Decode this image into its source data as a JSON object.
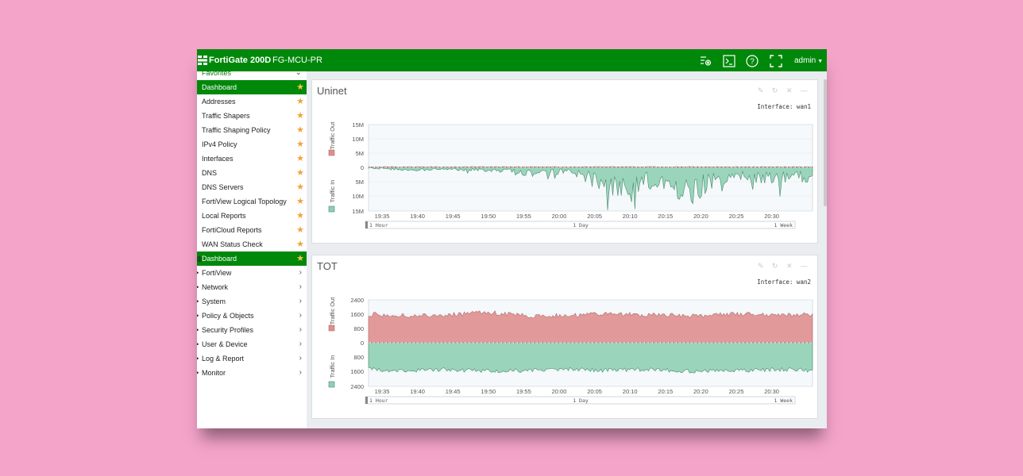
{
  "topbar": {
    "product": "FortiGate 200D",
    "hostname": "FG-MCU-PR",
    "user": "admin",
    "icons": [
      "dashboard-settings-icon",
      "cli-console-icon",
      "help-icon",
      "fullscreen-icon"
    ],
    "color": "#00880a"
  },
  "sidebar": {
    "favorites_label": "Favorites",
    "favorites": [
      {
        "label": "Dashboard",
        "active": true
      },
      {
        "label": "Addresses"
      },
      {
        "label": "Traffic Shapers"
      },
      {
        "label": "Traffic Shaping Policy"
      },
      {
        "label": "IPv4 Policy"
      },
      {
        "label": "Interfaces"
      },
      {
        "label": "DNS"
      },
      {
        "label": "DNS Servers"
      },
      {
        "label": "FortiView Logical Topology"
      },
      {
        "label": "Local Reports"
      },
      {
        "label": "FortiCloud Reports"
      },
      {
        "label": "WAN Status Check"
      }
    ],
    "menu": [
      {
        "label": "Dashboard",
        "active": true
      },
      {
        "label": "FortiView"
      },
      {
        "label": "Network"
      },
      {
        "label": "System"
      },
      {
        "label": "Policy & Objects"
      },
      {
        "label": "Security Profiles"
      },
      {
        "label": "User & Device"
      },
      {
        "label": "Log & Report"
      },
      {
        "label": "Monitor"
      }
    ]
  },
  "widgets": [
    {
      "title": "Uninet",
      "interface": "Interface: wan1",
      "out_label": "Traffic Out",
      "in_label": "Traffic In",
      "y_ticks_out": [
        "15M",
        "10M",
        "5M",
        "0"
      ],
      "y_ticks_in": [
        "5M",
        "10M",
        "15M"
      ],
      "x_ticks": [
        "19:35",
        "19:40",
        "19:45",
        "19:50",
        "19:55",
        "20:00",
        "20:05",
        "20:10",
        "20:15",
        "20:20",
        "20:25",
        "20:30"
      ],
      "range_labels": [
        "1 Hour",
        "1 Day",
        "1 Week"
      ]
    },
    {
      "title": "TOT",
      "interface": "Interface: wan2",
      "out_label": "Traffic Out",
      "in_label": "Traffic In",
      "y_ticks_out": [
        "2400",
        "1600",
        "800",
        "0"
      ],
      "y_ticks_in": [
        "800",
        "1600",
        "2400"
      ],
      "x_ticks": [
        "19:35",
        "19:40",
        "19:45",
        "19:50",
        "19:55",
        "20:00",
        "20:05",
        "20:10",
        "20:15",
        "20:20",
        "20:25",
        "20:30"
      ],
      "range_labels": [
        "1 Hour",
        "1 Day",
        "1 Week"
      ]
    }
  ],
  "chart_data": [
    {
      "type": "area",
      "title": "Uninet",
      "x": [
        "19:35",
        "19:40",
        "19:45",
        "19:50",
        "19:55",
        "20:00",
        "20:05",
        "20:10",
        "20:15",
        "20:20",
        "20:25",
        "20:30"
      ],
      "series": [
        {
          "name": "Traffic Out",
          "values": [
            0.2,
            0.2,
            0.2,
            0.2,
            0.2,
            0.2,
            0.2,
            0.2,
            0.2,
            0.2,
            0.2,
            0.2
          ],
          "unit": "M",
          "color": "#e08e8e"
        },
        {
          "name": "Traffic In",
          "values": [
            0.3,
            1.0,
            0.8,
            1.2,
            2.5,
            1.5,
            8.0,
            6.0,
            10.0,
            3.0,
            5.0,
            4.0
          ],
          "unit": "M",
          "color": "#8fcfb4"
        }
      ],
      "ylim": [
        -15,
        15
      ]
    },
    {
      "type": "area",
      "title": "TOT",
      "x": [
        "19:35",
        "19:40",
        "19:45",
        "19:50",
        "19:55",
        "20:00",
        "20:05",
        "20:10",
        "20:15",
        "20:20",
        "20:25",
        "20:30"
      ],
      "series": [
        {
          "name": "Traffic Out",
          "values": [
            1600,
            1500,
            1550,
            1700,
            1500,
            1550,
            1600,
            1550,
            1500,
            1600,
            1550,
            1600
          ],
          "color": "#e08e8e"
        },
        {
          "name": "Traffic In",
          "values": [
            1500,
            1550,
            1500,
            1600,
            1550,
            1500,
            1550,
            1500,
            1600,
            1550,
            1500,
            1550
          ],
          "color": "#8fcfb4"
        }
      ],
      "ylim": [
        -2400,
        2400
      ]
    }
  ]
}
